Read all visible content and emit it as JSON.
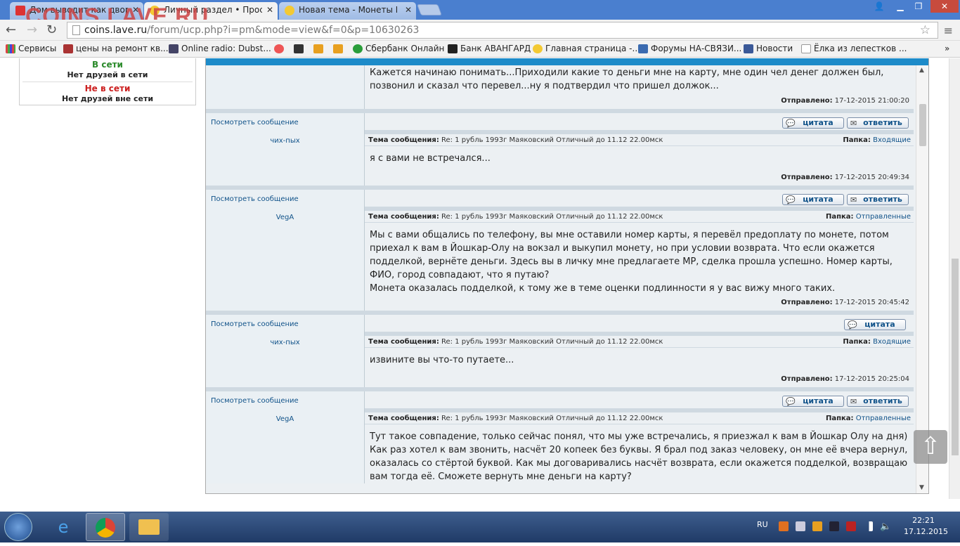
{
  "browser": {
    "site_logo": "COINS.LAVE.RU",
    "tabs": [
      {
        "title": "Дом выводит как двор"
      },
      {
        "title": "Личный раздел • Просмо"
      },
      {
        "title": "Новая тема - Монеты Рос"
      }
    ],
    "url_domain": "coins.lave.ru",
    "url_path": "/forum/ucp.php?i=pm&mode=view&f=0&p=10630263",
    "bookmarks": [
      "Сервисы",
      "цены на ремонт кв...",
      "Online radio: Dubst...",
      "Сбербанк Онлайн",
      "Банк АВАНГАРД",
      "Главная страница -...",
      "Форумы НА-СВЯЗИ...",
      "Новости",
      "Ёлка из лепестков ..."
    ]
  },
  "friends": {
    "online_label": "В сети",
    "online_empty": "Нет друзей в сети",
    "offline_label": "Не в сети",
    "offline_empty": "Нет друзей вне сети"
  },
  "labels": {
    "subject": "Тема сообщения:",
    "folder": "Папка:",
    "sent": "Отправлено:",
    "view_message": "Посмотреть сообщение",
    "quote": "цитата",
    "reply": "ответить"
  },
  "messages": [
    {
      "author": "",
      "subject": "",
      "folder": "",
      "body": "Кажется начинаю понимать...Приходили какие то деньги мне на карту, мне один чел денег должен был, позвонил и сказал что перевел...ну я подтвердил что пришел должок...",
      "sent": "17-12-2015 21:00:20",
      "has_reply": true
    },
    {
      "author": "чих-пых",
      "subject": "Re: 1 рубль 1993г Маяковский Отличный до 11.12 22.00мск",
      "folder": "Входящие",
      "body": "я с вами не встречался...",
      "sent": "17-12-2015 20:49:34",
      "has_reply": true
    },
    {
      "author": "VegA",
      "subject": "Re: 1 рубль 1993г Маяковский Отличный до 11.12 22.00мск",
      "folder": "Отправленные",
      "body": "Мы с вами общались по телефону, вы мне оставили номер карты, я перевёл предоплату по монете, потом приехал к вам в Йошкар-Олу на вокзал и выкупил монету, но при условии возврата. Что если окажется подделкой, вернёте деньги. Здесь вы в личку мне предлагаете МР, сделка прошла успешно. Номер карты, ФИО, город совпадают, что я путаю?",
      "body2": "Монета оказалась подделкой, к тому же в теме оценки подлинности я у вас вижу много таких.",
      "sent": "17-12-2015 20:45:42",
      "has_reply": false
    },
    {
      "author": "чих-пых",
      "subject": "Re: 1 рубль 1993г Маяковский Отличный до 11.12 22.00мск",
      "folder": "Входящие",
      "body": "извините вы что-то путаете...",
      "sent": "17-12-2015 20:25:04",
      "has_reply": true
    },
    {
      "author": "VegA",
      "subject": "Re: 1 рубль 1993г Маяковский Отличный до 11.12 22.00мск",
      "folder": "Отправленные",
      "body": "Тут такое совпадение, только сейчас понял, что мы уже встречались, я приезжал к вам в Йошкар Олу на дня) Как раз хотел к вам звонить, насчёт 20 копеек без буквы. Я брал под заказ человеку, он мне её вчера вернул, оказалась со стёртой буквой. Как мы договаривались насчёт возврата, если окажется подделкой, возвращаю вам тогда её. Сможете вернуть мне деньги на карту?"
    }
  ],
  "taskbar": {
    "lang": "RU",
    "time": "22:21",
    "date": "17.12.2015"
  },
  "colors": {
    "accent": "#1d8bc9",
    "link": "#105289",
    "online": "#2a8a2a",
    "offline": "#cc2020"
  }
}
